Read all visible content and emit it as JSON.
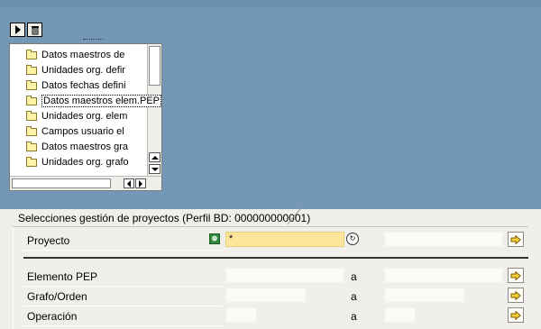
{
  "tree": {
    "nodes": [
      {
        "label": "Datos maestros de"
      },
      {
        "label": "Unidades org. defir"
      },
      {
        "label": "Datos fechas defini"
      },
      {
        "label": "Datos maestros elem.PEP"
      },
      {
        "label": "Unidades org. elem"
      },
      {
        "label": "Campos usuario el"
      },
      {
        "label": "Datos maestros gra"
      },
      {
        "label": "Unidades org. grafo"
      }
    ]
  },
  "panel": {
    "tab_title": "Selecciones gestión de proyectos (Perfil BD: 000000000001)",
    "rows": [
      {
        "label": "Proyecto",
        "value": "*",
        "to_label": ""
      },
      {
        "label": "Elemento PEP",
        "value": "",
        "to_label": "a"
      },
      {
        "label": "Grafo/Orden",
        "value": "",
        "to_label": "a"
      },
      {
        "label": "Operación",
        "value": "",
        "to_label": "a"
      }
    ]
  },
  "icons": {
    "execute": "play-icon",
    "delete": "trash-icon",
    "multiple_selection": "multi-select-icon",
    "arrow": "right-arrow-icon"
  }
}
